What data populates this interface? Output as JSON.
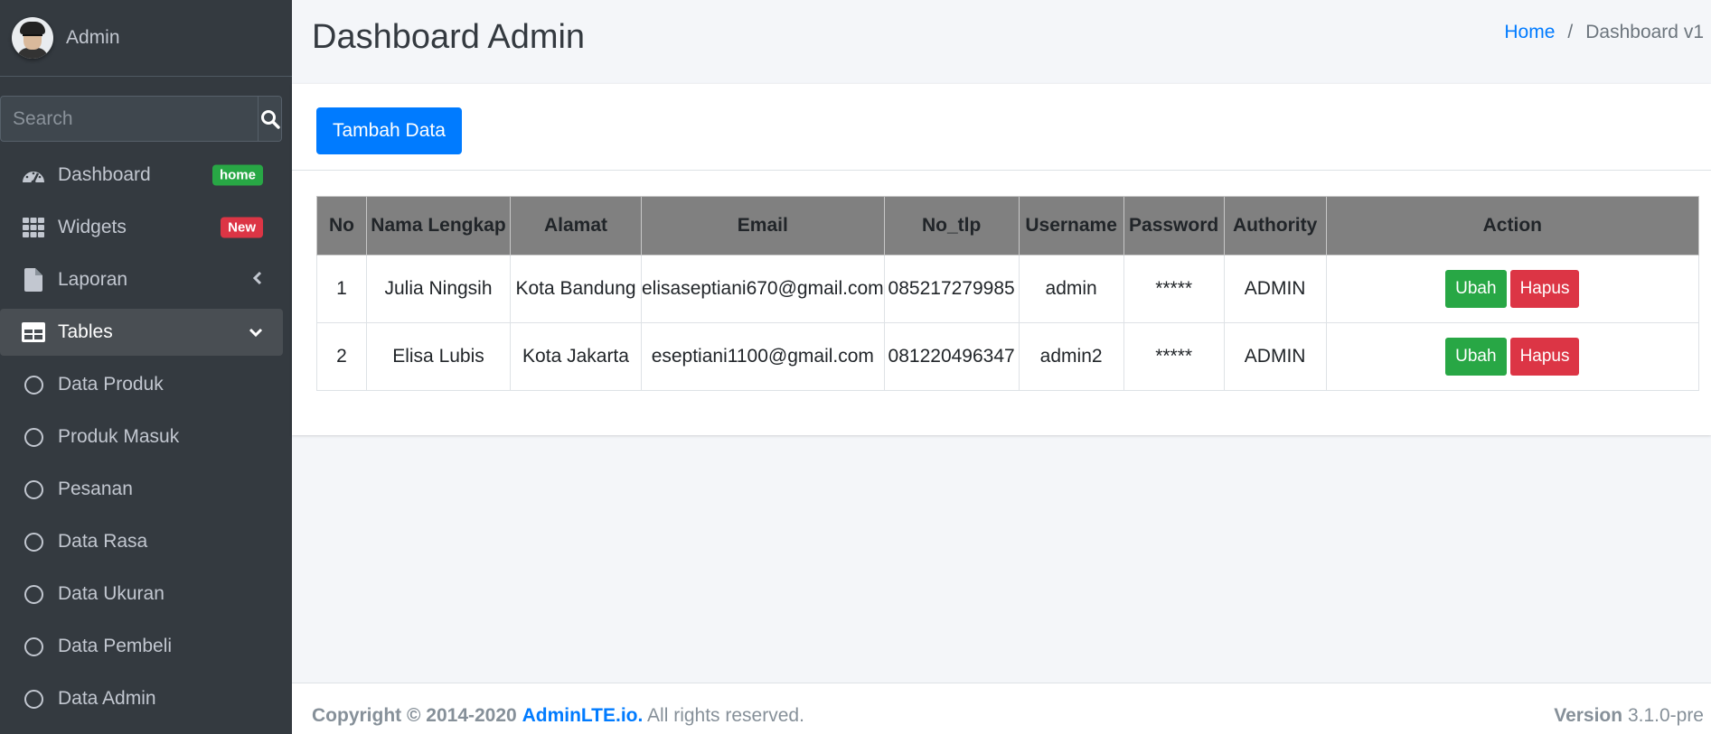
{
  "user": {
    "name": "Admin"
  },
  "search": {
    "placeholder": "Search"
  },
  "nav": [
    {
      "label": "Dashboard",
      "icon": "tachometer-icon",
      "badge": "home",
      "badge_color": "#28a745"
    },
    {
      "label": "Widgets",
      "icon": "grid-icon",
      "badge": "New",
      "badge_color": "#dc3545"
    },
    {
      "label": "Laporan",
      "icon": "file-icon",
      "arrow": "chevron-left-icon"
    },
    {
      "label": "Tables",
      "icon": "table-icon",
      "arrow": "chevron-down-icon",
      "active": true
    },
    {
      "label": "Data Produk",
      "icon": "circle-icon"
    },
    {
      "label": "Produk Masuk",
      "icon": "circle-icon"
    },
    {
      "label": "Pesanan",
      "icon": "circle-icon"
    },
    {
      "label": "Data Rasa",
      "icon": "circle-icon"
    },
    {
      "label": "Data Ukuran",
      "icon": "circle-icon"
    },
    {
      "label": "Data Pembeli",
      "icon": "circle-icon"
    },
    {
      "label": "Data Admin",
      "icon": "circle-icon"
    }
  ],
  "header": {
    "title": "Dashboard Admin",
    "breadcrumb": {
      "home": "Home",
      "separator": "/",
      "current": "Dashboard v1"
    }
  },
  "card": {
    "add_button": "Tambah Data"
  },
  "table": {
    "columns": [
      "No",
      "Nama Lengkap",
      "Alamat",
      "Email",
      "No_tlp",
      "Username",
      "Password",
      "Authority",
      "Action"
    ],
    "rows": [
      {
        "no": "1",
        "nama": "Julia Ningsih",
        "alamat": "Kota Bandung",
        "email": "elisaseptiani670@gmail.com",
        "tlp": "085217279985",
        "username": "admin",
        "password": "*****",
        "authority": "ADMIN"
      },
      {
        "no": "2",
        "nama": "Elisa Lubis",
        "alamat": "Kota Jakarta",
        "email": "eseptiani1100@gmail.com",
        "tlp": "081220496347",
        "username": "admin2",
        "password": "*****",
        "authority": "ADMIN"
      }
    ],
    "edit_label": "Ubah",
    "delete_label": "Hapus"
  },
  "footer": {
    "copyright": "Copyright © 2014-2020",
    "brand": "AdminLTE.io.",
    "rights": "All rights reserved.",
    "version_label": "Version",
    "version": "3.1.0-pre"
  },
  "colors": {
    "primary": "#007bff",
    "success": "#28a745",
    "danger": "#dc3545",
    "sidebar": "#343a40"
  }
}
